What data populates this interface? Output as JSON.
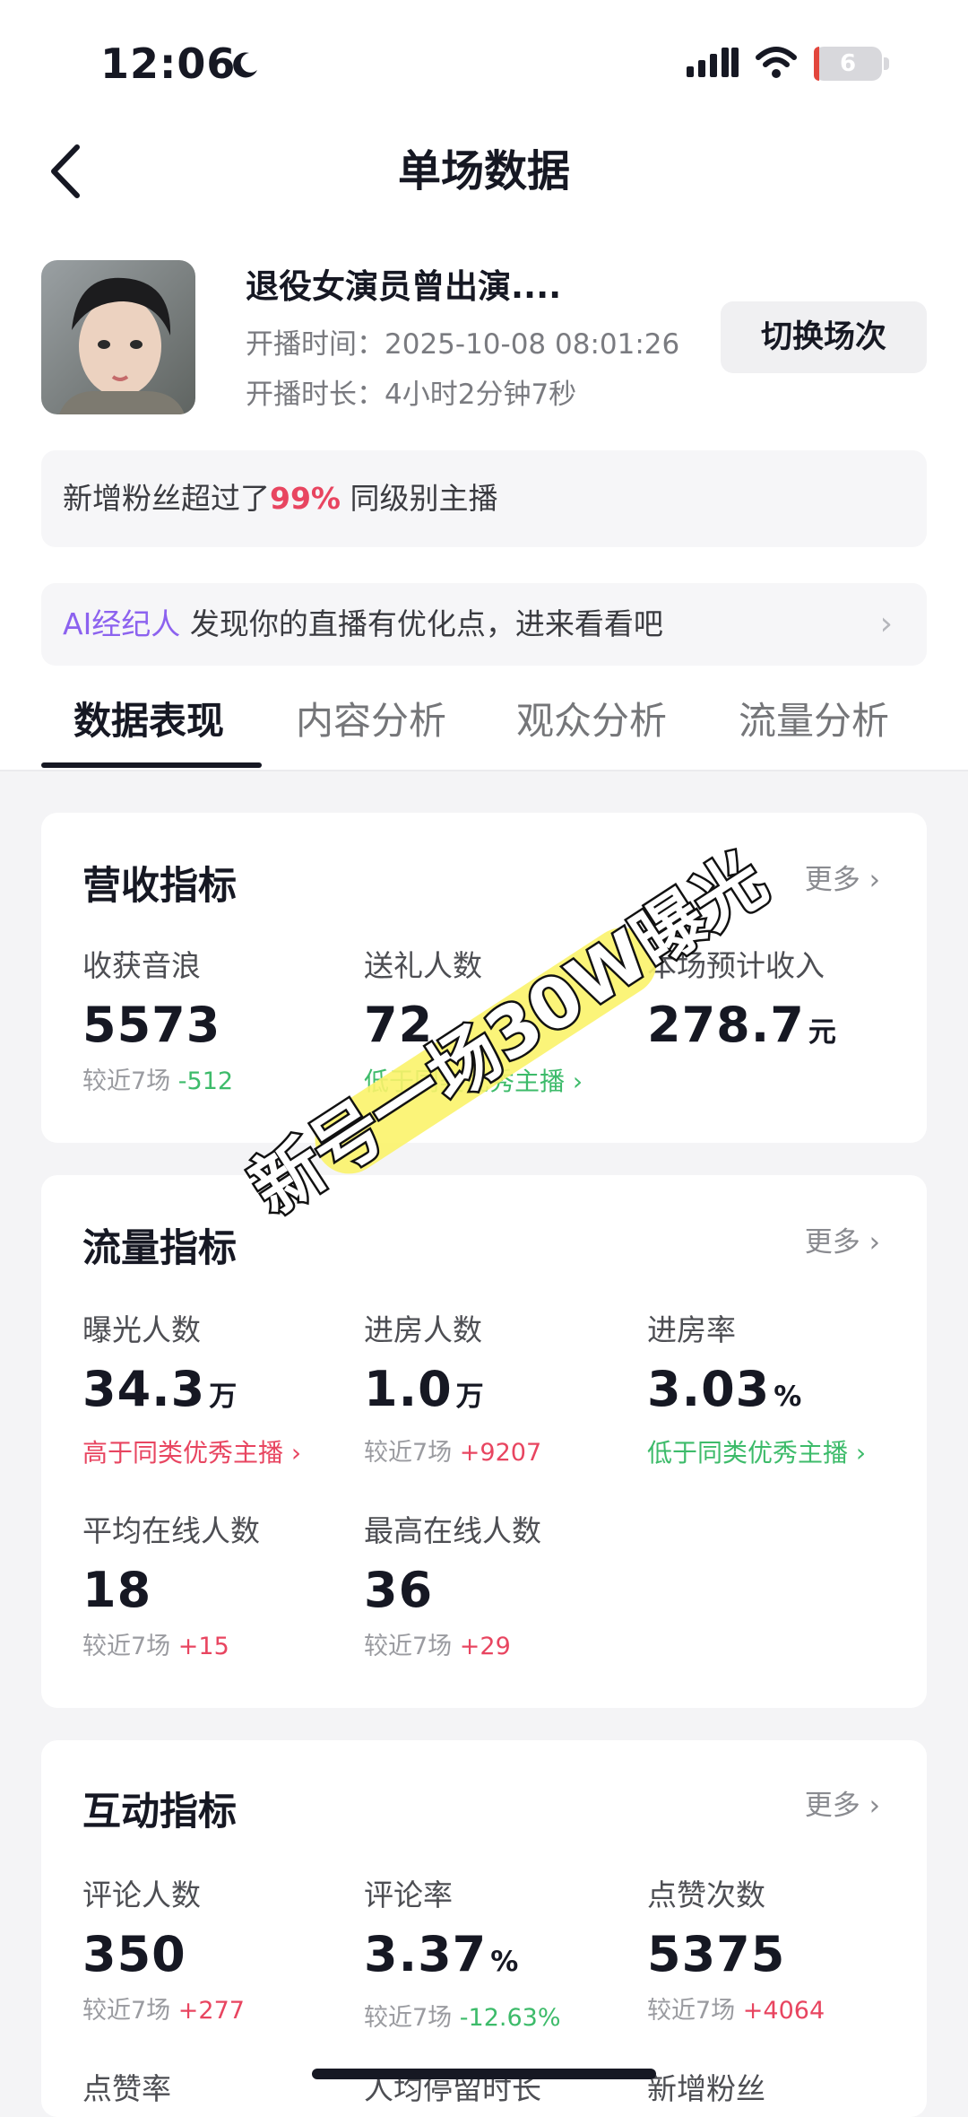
{
  "status_bar": {
    "time": "12:06",
    "battery": "6"
  },
  "nav": {
    "title": "单场数据"
  },
  "live": {
    "title": "退役女演员曾出演....",
    "start_time_label": "开播时间：",
    "start_time": "2025-10-08 08:01:26",
    "duration_label": "开播时长：",
    "duration": "4小时2分钟7秒",
    "switch_label": "切换场次"
  },
  "fans_banner": {
    "prefix": "新增粉丝超过了",
    "percent": "99%",
    "suffix": "同级别主播"
  },
  "ai_banner": {
    "label": "AI经纪人",
    "text": "发现你的直播有优化点，进来看看吧"
  },
  "tabs": [
    {
      "label": "数据表现",
      "active": true
    },
    {
      "label": "内容分析",
      "active": false
    },
    {
      "label": "观众分析",
      "active": false
    },
    {
      "label": "流量分析",
      "active": false
    }
  ],
  "more_label": "更多",
  "revenue": {
    "title": "营收指标",
    "metrics": [
      {
        "label": "收获音浪",
        "value": "5573",
        "unit": "",
        "sub_prefix": "较近7场",
        "sub_delta": "-512"
      },
      {
        "label": "送礼人数",
        "value": "72",
        "unit": "",
        "hint": "低于同类优秀主播"
      },
      {
        "label": "本场预计收入",
        "value": "278.7",
        "unit": "元"
      }
    ]
  },
  "traffic": {
    "title": "流量指标",
    "metrics": [
      {
        "label": "曝光人数",
        "value": "34.3",
        "unit": "万",
        "hint": "高于同类优秀主播"
      },
      {
        "label": "进房人数",
        "value": "1.0",
        "unit": "万",
        "sub_prefix": "较近7场",
        "sub_delta": "+9207"
      },
      {
        "label": "进房率",
        "value": "3.03",
        "unit": "%",
        "hint": "低于同类优秀主播"
      },
      {
        "label": "平均在线人数",
        "value": "18",
        "unit": "",
        "sub_prefix": "较近7场",
        "sub_delta": "+15"
      },
      {
        "label": "最高在线人数",
        "value": "36",
        "unit": "",
        "sub_prefix": "较近7场",
        "sub_delta": "+29"
      }
    ]
  },
  "interaction": {
    "title": "互动指标",
    "metrics": [
      {
        "label": "评论人数",
        "value": "350",
        "unit": "",
        "sub_prefix": "较近7场",
        "sub_delta": "+277"
      },
      {
        "label": "评论率",
        "value": "3.37",
        "unit": "%",
        "sub_prefix": "较近7场",
        "sub_delta": "-12.63%"
      },
      {
        "label": "点赞次数",
        "value": "5375",
        "unit": "",
        "sub_prefix": "较近7场",
        "sub_delta": "+4064"
      },
      {
        "label": "点赞率"
      },
      {
        "label": "人均停留时长"
      },
      {
        "label": "新增粉丝"
      }
    ]
  },
  "overlay_text": "新号一场30W曝光",
  "colors": {
    "accent_red": "#e84560",
    "accent_green": "#3dbb6a",
    "ai_purple": "#8c62ef",
    "highlight": "#fbf36a"
  }
}
